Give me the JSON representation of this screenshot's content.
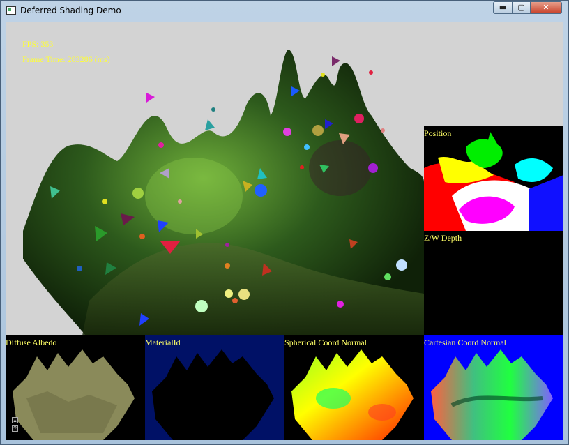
{
  "window": {
    "title": "Deferred Shading Demo",
    "minimize_icon": "minimize-icon",
    "maximize_icon": "maximize-icon",
    "close_icon": "close-icon"
  },
  "hud": {
    "fps": "FPS: 353",
    "frame_time": "Frame Time: 283286 (ms)"
  },
  "panels": {
    "position": "Position",
    "depth": "Z/W Depth",
    "albedo": "Diffuse Albedo",
    "material": "MaterialId",
    "spherical": "Spherical Coord Normal",
    "cartesian": "Cartesian Coord Normal"
  },
  "colors": {
    "hud_text": "#ffff33",
    "panel_label": "#ffff66",
    "background": "#d3d3d3",
    "material_bg": "#001166",
    "cartesian_bg": "#0000ff"
  }
}
